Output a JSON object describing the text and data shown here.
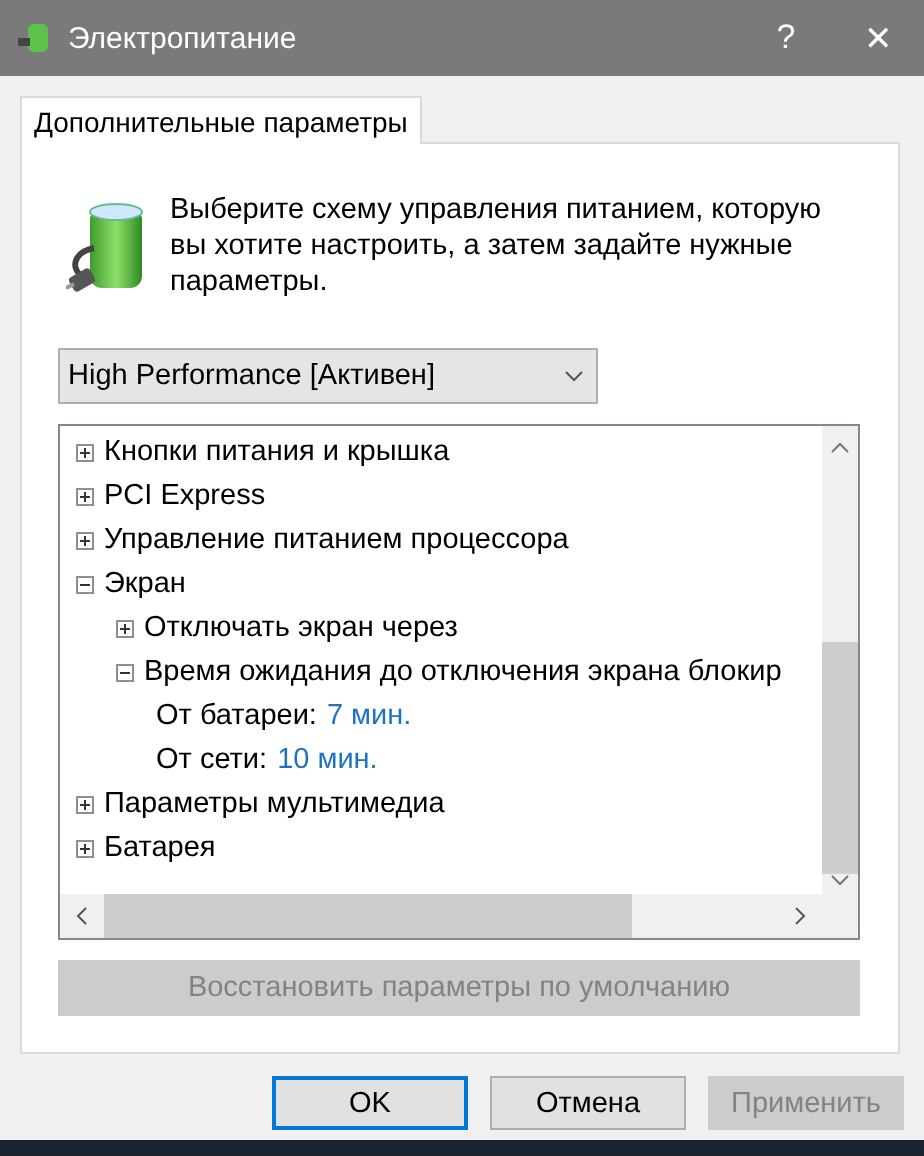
{
  "window": {
    "title": "Электропитание",
    "help": "?",
    "close": "✕"
  },
  "tabs": [
    {
      "label": "Дополнительные параметры",
      "selected": true
    }
  ],
  "intro": "Выберите схему управления питанием, которую вы хотите настроить, а затем задайте нужные параметры.",
  "plan_select": {
    "value": "High Performance [Активен]"
  },
  "tree": [
    {
      "kind": "group",
      "label": "Кнопки питания и крышка",
      "expanded": false
    },
    {
      "kind": "group",
      "label": "PCI Express",
      "expanded": false
    },
    {
      "kind": "group",
      "label": "Управление питанием процессора",
      "expanded": false
    },
    {
      "kind": "group",
      "label": "Экран",
      "expanded": true,
      "children": [
        {
          "kind": "group",
          "label": "Отключать экран через",
          "expanded": false
        },
        {
          "kind": "group",
          "label": "Время ожидания до отключения экрана блокир",
          "expanded": true,
          "children": [
            {
              "kind": "setting",
              "label": "От батареи:",
              "value": "7 мин."
            },
            {
              "kind": "setting",
              "label": "От сети:",
              "value": "10 мин."
            }
          ]
        }
      ]
    },
    {
      "kind": "group",
      "label": "Параметры мультимедиа",
      "expanded": false
    },
    {
      "kind": "group",
      "label": "Батарея",
      "expanded": false
    }
  ],
  "restore_button": {
    "label": "Восстановить параметры по умолчанию",
    "disabled": true
  },
  "buttons": [
    {
      "label": "OK",
      "disabled": false,
      "default": true
    },
    {
      "label": "Отмена",
      "disabled": false,
      "default": false
    },
    {
      "label": "Применить",
      "disabled": true,
      "default": false
    }
  ]
}
